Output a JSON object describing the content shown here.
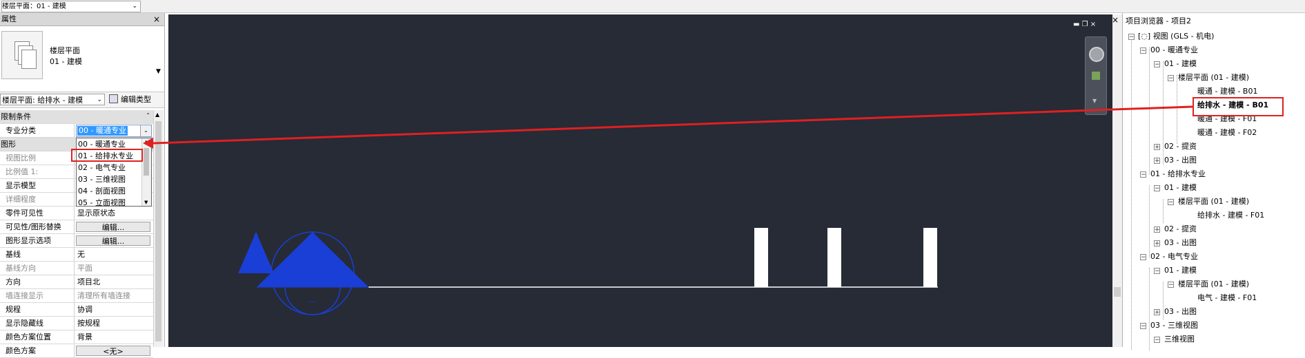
{
  "topbar": {
    "view_selector": "楼层平面：01 - 建模"
  },
  "properties": {
    "title": "属性",
    "type_name_line1": "楼层平面",
    "type_name_line2": "01 - 建模",
    "instance_selector": "楼层平面: 给排水 - 建模",
    "edit_type_label": "编辑类型",
    "rows": {
      "constraints_section": "限制条件",
      "discipline_label": "专业分类",
      "graphics_section": "图形",
      "view_scale_label": "视图比例",
      "scale_value_label": "比例值 1:",
      "display_model_label": "显示模型",
      "detail_level_label": "详细程度",
      "parts_visibility_label": "零件可见性",
      "parts_visibility_value": "显示原状态",
      "vg_override_label": "可见性/图形替换",
      "vg_override_button": "编辑...",
      "graphic_display_label": "图形显示选项",
      "graphic_display_button": "编辑...",
      "underlay_label": "基线",
      "underlay_value": "无",
      "underlay_orientation_label": "基线方向",
      "underlay_orientation_value": "平面",
      "orientation_label": "方向",
      "orientation_value": "项目北",
      "wall_join_label": "墙连接显示",
      "wall_join_value": "清理所有墙连接",
      "discipline2_label": "规程",
      "discipline2_value": "协调",
      "hidden_lines_label": "显示隐藏线",
      "hidden_lines_value": "按规程",
      "color_scheme_location_label": "颜色方案位置",
      "color_scheme_location_value": "背景",
      "color_scheme_label": "颜色方案",
      "color_scheme_button": "<无>"
    },
    "discipline_selected": "00 - 暖通专业",
    "dropdown_options": [
      "00 - 暖通专业",
      "01 - 给排水专业",
      "02 - 电气专业",
      "03 - 三维视图",
      "04 - 剖面视图",
      "05 - 立面视图"
    ]
  },
  "browser": {
    "title": "项目浏览器 - 项目2",
    "nodes": {
      "root": "视图 (GLS - 机电)",
      "hvac": "00 - 暖通专业",
      "hvac_model": "01 - 建模",
      "hvac_floorplan": "楼层平面 (01 - 建模)",
      "hvac_b01": "暖通 - 建模 - B01",
      "plumb_b01": "给排水 - 建模 - B01",
      "hvac_f01": "暖通 - 建模 - F01",
      "hvac_f02": "暖通 - 建模 - F02",
      "hvac_submit": "02 - 提资",
      "hvac_output": "03 - 出图",
      "plumb": "01 - 给排水专业",
      "plumb_model": "01 - 建模",
      "plumb_floorplan": "楼层平面 (01 - 建模)",
      "plumb_f01": "给排水 - 建模 - F01",
      "plumb_submit": "02 - 提资",
      "plumb_output": "03 - 出图",
      "elec": "02 - 电气专业",
      "elec_model": "01 - 建模",
      "elec_floorplan": "楼层平面 (01 - 建模)",
      "elec_f01": "电气 - 建模 - F01",
      "elec_output": "03 - 出图",
      "threed": "03 - 三维视图",
      "threed_view": "三维视图"
    }
  },
  "colors": {
    "canvas_bg": "#262b36",
    "highlight_red": "#e02020",
    "selection_blue": "#3399ff",
    "symbol_blue": "#1a3fd6"
  }
}
